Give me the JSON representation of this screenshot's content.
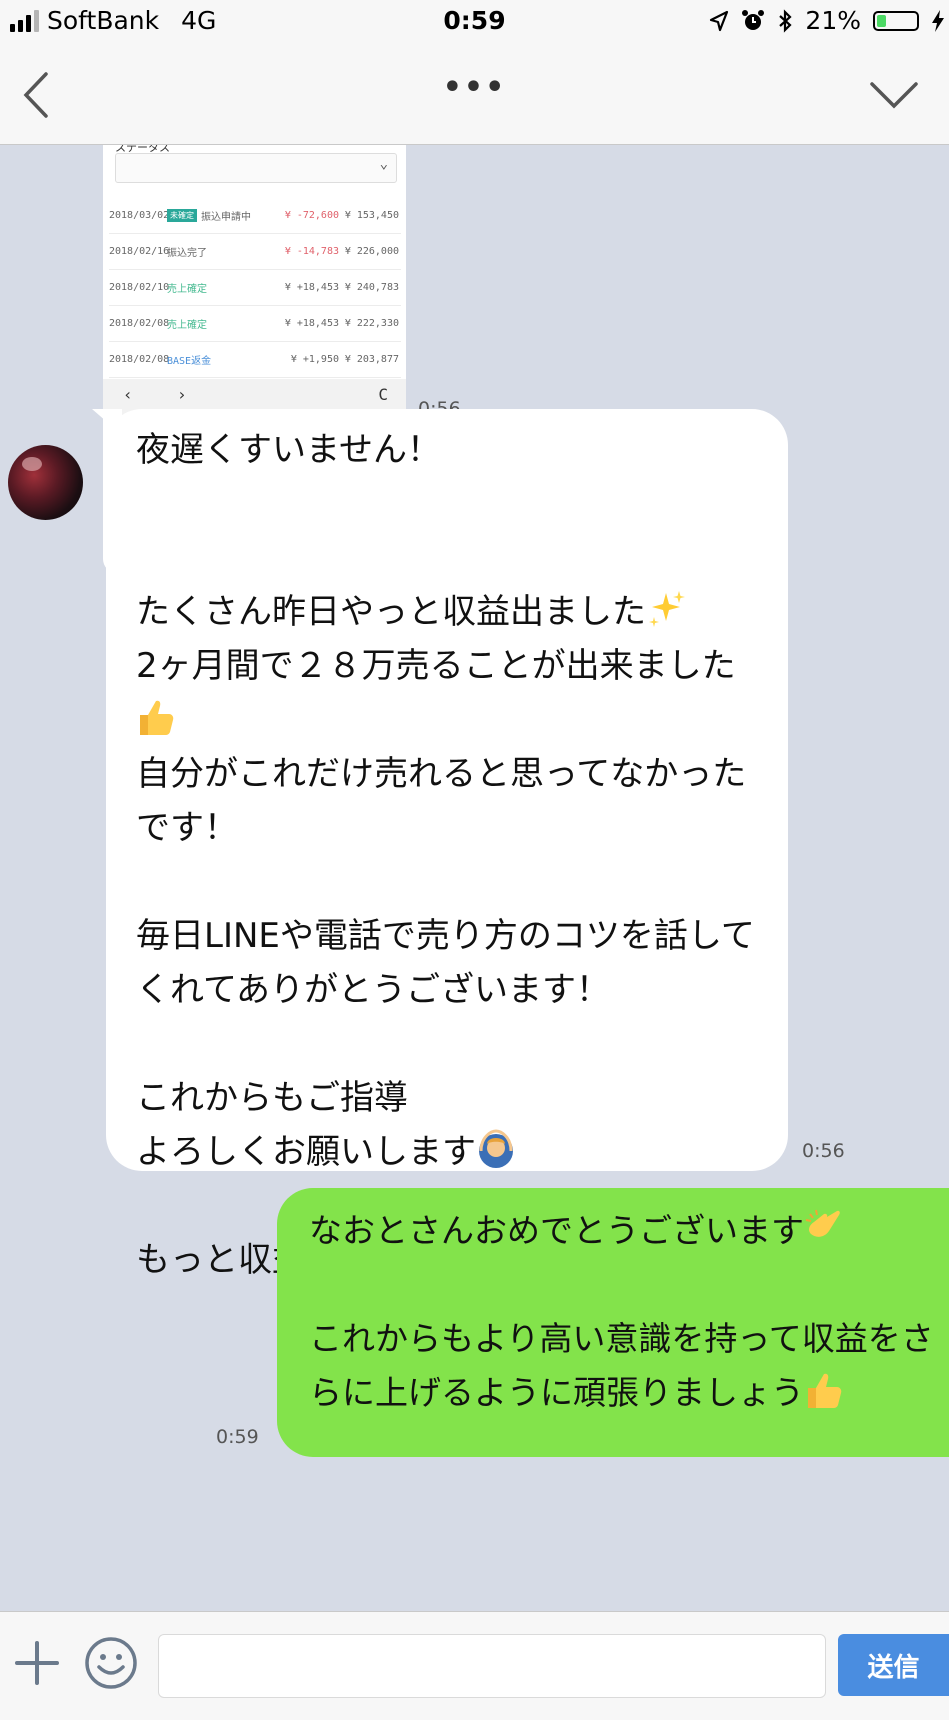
{
  "status_bar": {
    "carrier": "SoftBank",
    "network": "4G",
    "time": "0:59",
    "battery": "21%",
    "battery_level": 0.21
  },
  "navbar": {
    "more": "•••"
  },
  "screenshot": {
    "status_label": "ステータス",
    "rows": [
      {
        "date": "2018/03/02",
        "tag": "未確定",
        "status": "振込申請中",
        "amount": "¥ -72,600",
        "balance": "¥ 153,450"
      },
      {
        "date": "2018/02/16",
        "status": "振込完了",
        "amount": "¥ -14,783",
        "balance": "¥ 226,000"
      },
      {
        "date": "2018/02/10",
        "status": "売上確定",
        "amount": "¥ +18,453",
        "balance": "¥ 240,783"
      },
      {
        "date": "2018/02/08",
        "status": "売上確定",
        "amount": "¥ +18,453",
        "balance": "¥ 222,330"
      },
      {
        "date": "2018/02/08",
        "status": "BASE返金",
        "amount": "¥ +1,950",
        "balance": "¥ 203,877"
      }
    ],
    "nav_prev": "‹",
    "nav_next": "›",
    "nav_reload": "C"
  },
  "messages": {
    "image_time": "0:56",
    "incoming": {
      "text1": "夜遅くすいません！\n\n\nたくさん昨日やっと収益出ました",
      "text2": "\n2ヶ月間で２８万売ることが出来ました",
      "text3": "\n自分がこれだけ売れると思ってなかったです！\n\n毎日LINEや電話で売り方のコツを話してくれてありがとうございます！\n\nこれからもご指導\nよろしくお願いします",
      "text4": "\n\nもっと収益あげてみせます！",
      "time": "0:56"
    },
    "outgoing": {
      "text1": "なおとさんおめでとうございます",
      "text2": "\n\nこれからもより高い意識を持って収益をさらに上げるように頑張りましょう",
      "time": "0:59"
    }
  },
  "input_bar": {
    "send_label": "送信"
  },
  "colors": {
    "chat_bg": "#d6dbe6",
    "outgoing_bubble": "#83e34b",
    "send_button": "#4a8de0"
  }
}
